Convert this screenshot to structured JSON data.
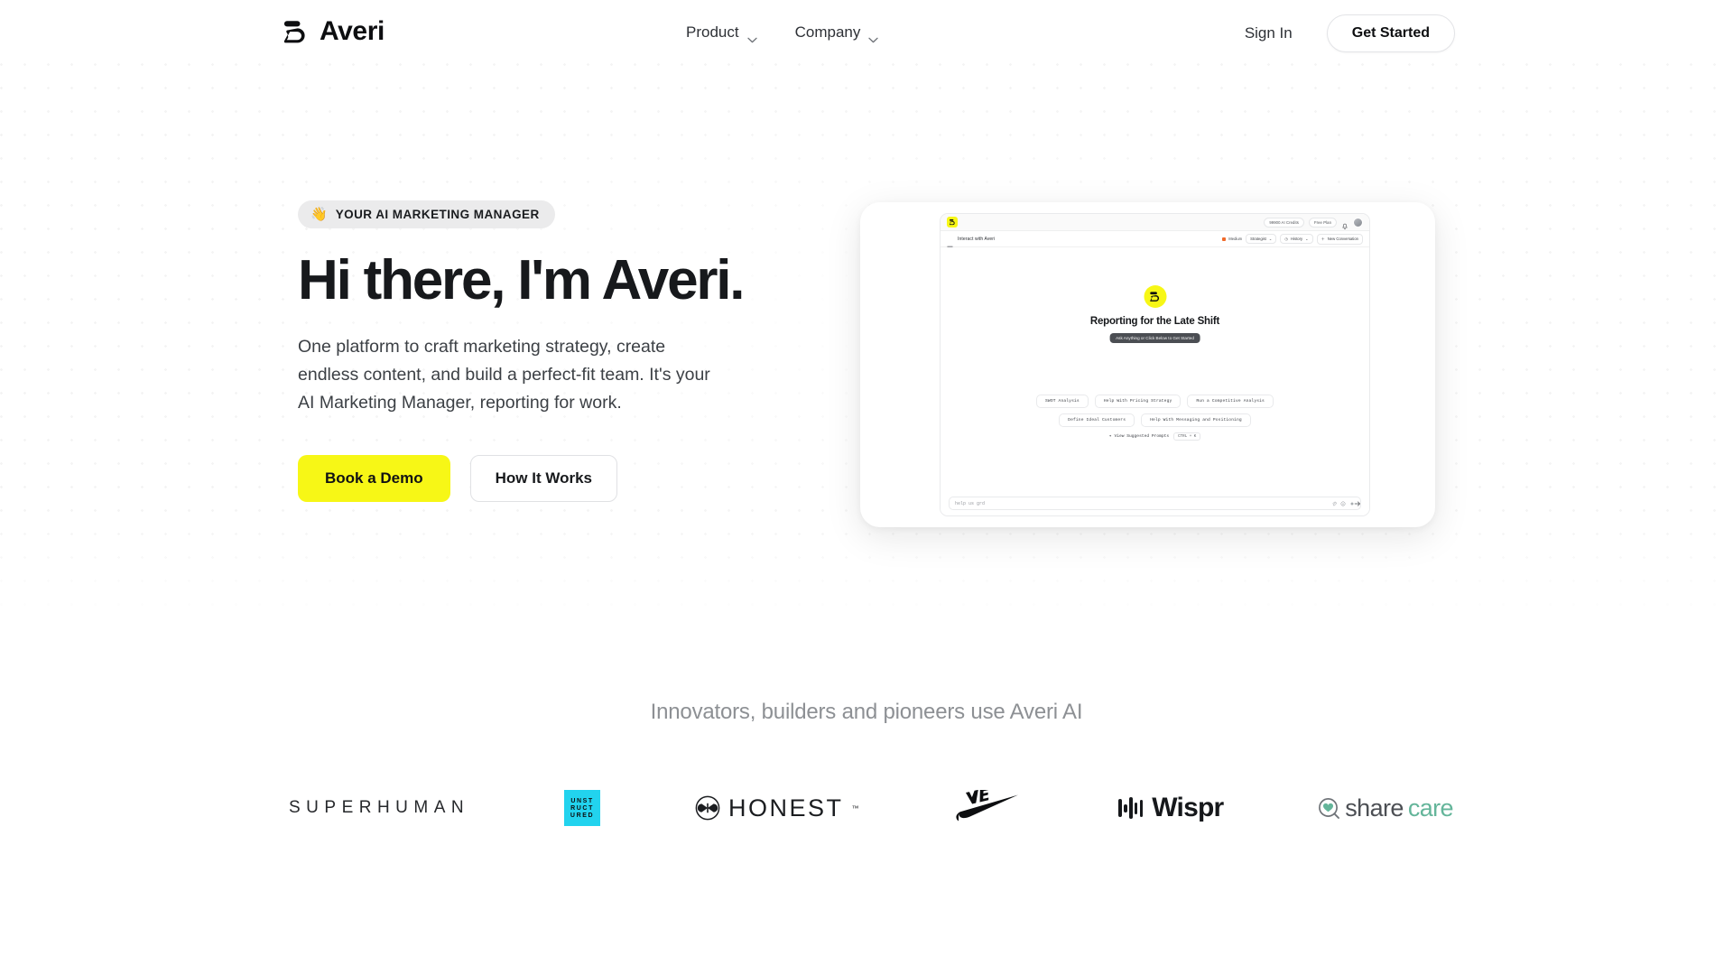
{
  "brand": {
    "name": "Averi",
    "logo_icon": "averi-logo-mark"
  },
  "nav": {
    "items": [
      {
        "label": "Product",
        "icon": "chevron-down-icon"
      },
      {
        "label": "Company",
        "icon": "chevron-down-icon"
      }
    ],
    "sign_in": "Sign In",
    "get_started": "Get Started"
  },
  "hero": {
    "badge": {
      "emoji": "👋",
      "text": "YOUR AI MARKETING MANAGER"
    },
    "headline": "Hi there, I'm Averi.",
    "subcopy": "One platform to craft marketing strategy, create endless content, and build a perfect-fit team. It's your AI Marketing Manager, reporting for work.",
    "primary_cta": "Book a Demo",
    "secondary_cta": "How It Works",
    "accent_color": "#F7F716"
  },
  "app_preview": {
    "topbar": {
      "credits": "99900 AI Credits",
      "plan": "Free Plan",
      "bell_icon": "bell-icon",
      "avatar": "user-avatar"
    },
    "subbar": {
      "title": "Interact with Averi",
      "mode": "Medium",
      "mode_color": "#F06A2A",
      "persona": "Strategist",
      "history": "History",
      "new_conversation": "New Conversation"
    },
    "main": {
      "title": "Reporting for the Late Shift",
      "hint_pill": "Ask Anything or Click Below to Get Started",
      "suggestions_row1": [
        "SWOT Analysis",
        "Help With Pricing Strategy",
        "Run a Competitive Analysis"
      ],
      "suggestions_row2": [
        "Define Ideal Customers",
        "Help With Messaging and Positioning"
      ],
      "prompts_label": "View Suggested Prompts",
      "prompts_shortcut": "CTRL + K"
    },
    "composer": {
      "placeholder": "help us grd",
      "icons": [
        "attach-icon",
        "emoji-icon",
        "sparkle-icon"
      ],
      "send_icon": "arrow-right-icon"
    }
  },
  "social_proof": {
    "title": "Innovators, builders and pioneers use Averi AI",
    "logos": [
      {
        "name": "SUPERHUMAN"
      },
      {
        "name": "UNSTRUCTURED",
        "lines": [
          "UNST",
          "RUCT",
          "URED"
        ],
        "color": "#22D3EE"
      },
      {
        "name": "HONEST",
        "tm": "™"
      },
      {
        "name": "NIKE"
      },
      {
        "name": "Wispr"
      },
      {
        "name": "sharecare",
        "part1": "share",
        "part2": "care",
        "color": "#64B59A"
      }
    ]
  }
}
